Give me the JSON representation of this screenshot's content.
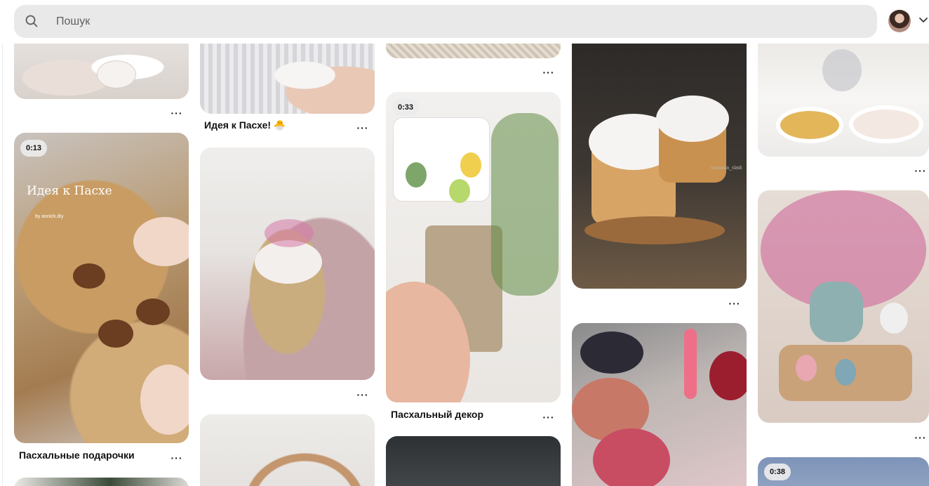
{
  "search": {
    "placeholder": "Пошук",
    "value": ""
  },
  "header": {
    "avatar_icon": "user-avatar",
    "menu_icon": "chevron-down-icon"
  },
  "pins": [
    {
      "id": "pin-c1-top",
      "caption": "",
      "duration": ""
    },
    {
      "id": "pin-c1-video",
      "caption": "Пасхальные подарочки",
      "duration": "0:13",
      "overlay_title": "Идея к Пасхе",
      "overlay_author": "by annick.diy"
    },
    {
      "id": "pin-c1-bottom",
      "caption": "",
      "duration": ""
    },
    {
      "id": "pin-c2-top",
      "caption": "Идея к Пасхе! 🐣",
      "duration": ""
    },
    {
      "id": "pin-c2-basket",
      "caption": "",
      "duration": ""
    },
    {
      "id": "pin-c2-bottom",
      "caption": "",
      "duration": ""
    },
    {
      "id": "pin-c3-top",
      "caption": "",
      "duration": ""
    },
    {
      "id": "pin-c3-video",
      "caption": "Пасхальный декор",
      "duration": "0:33"
    },
    {
      "id": "pin-c3-bottom",
      "caption": "",
      "duration": ""
    },
    {
      "id": "pin-c4-cakes",
      "caption": "",
      "duration": "",
      "overlay_author": "nastasia_sladi"
    },
    {
      "id": "pin-c4-eggs",
      "caption": "",
      "duration": ""
    },
    {
      "id": "pin-c5-top",
      "caption": "",
      "duration": ""
    },
    {
      "id": "pin-c5-flowers",
      "caption": "",
      "duration": ""
    },
    {
      "id": "pin-c5-video",
      "caption": "",
      "duration": "0:38"
    }
  ],
  "more_label": "···"
}
